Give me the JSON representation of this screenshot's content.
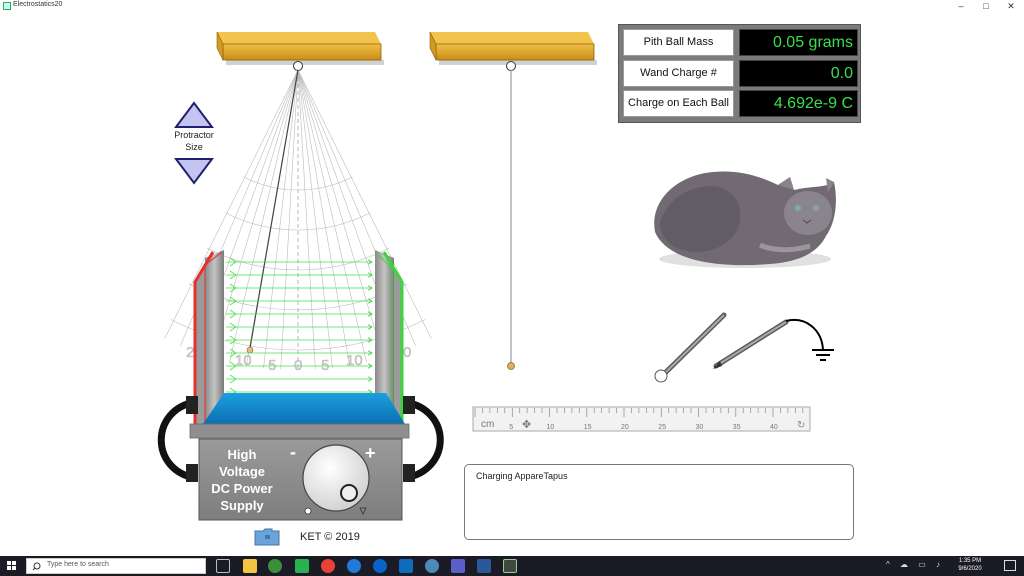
{
  "window": {
    "title": "Electrostatics20",
    "minimize": "–",
    "restore": "□",
    "close": "✕"
  },
  "readouts": [
    {
      "label": "Pith Ball Mass",
      "value": "0.05 grams"
    },
    {
      "label": "Wand Charge #",
      "value": "0.0"
    },
    {
      "label": "Charge on Each Ball",
      "value": "4.692e-9 C"
    }
  ],
  "protractor": {
    "label_line1": "Protractor",
    "label_line2": "Size"
  },
  "scale_labels": {
    "left_outer": "2",
    "left_10": "10",
    "left_5": "5",
    "zero": "0",
    "right_5": "5",
    "right_10": "10",
    "right_outer": "0"
  },
  "ruler": {
    "unit": "cm",
    "ticks": [
      "5",
      "10",
      "15",
      "20",
      "25",
      "30",
      "35",
      "40"
    ]
  },
  "power_supply": {
    "line1": "High",
    "line2": "Voltage",
    "line3": "DC Power",
    "line4": "Supply",
    "minus": "-",
    "plus": "+"
  },
  "charging_box": {
    "text": "Charging AppareTapus"
  },
  "footer": {
    "copyright": "KET © 2019"
  },
  "taskbar": {
    "search_placeholder": "Type here to search",
    "time": "1:35 PM",
    "date": "9/6/2020"
  },
  "colors": {
    "readout_green": "#38e04a",
    "wood": "#e2a62a",
    "plate_red": "#e53030",
    "plate_green": "#3bd53b",
    "field_green": "#49e049",
    "tray_blue": "#1e8fd0"
  }
}
